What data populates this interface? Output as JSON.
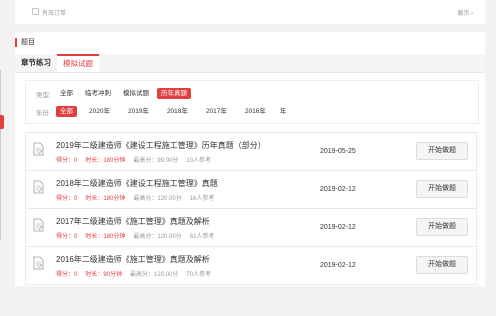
{
  "topbar": {
    "label": "有效订单",
    "right": "展示 ›"
  },
  "section": {
    "title": "题目"
  },
  "tabs": [
    {
      "label": "章节练习"
    },
    {
      "label": "模拟试题"
    }
  ],
  "filter": {
    "type_label": "类型:",
    "types": [
      "全部",
      "临考冲刺",
      "模拟试题",
      "历年真题"
    ],
    "year_label": "年份:",
    "years": [
      "全部",
      "2020年",
      "2019年",
      "2018年",
      "2017年",
      "2016年",
      "年"
    ]
  },
  "items": [
    {
      "title": "2019年二级建造师《建设工程施工管理》历年真题（部分）",
      "score": "得分：0",
      "duration": "时长：180分钟",
      "max": "最高分：99.00分",
      "count": "10人参考",
      "date": "2019-05-25",
      "button": "开始做题"
    },
    {
      "title": "2018年二级建造师《建设工程施工管理》真题",
      "score": "得分：0",
      "duration": "时长：180分钟",
      "max": "最高分：120.00分",
      "count": "16人参考",
      "date": "2019-02-12",
      "button": "开始做题"
    },
    {
      "title": "2017年二级建造师《施工管理》真题及解析",
      "score": "得分：0",
      "duration": "时长：180分钟",
      "max": "最高分：120.00分",
      "count": "61人参考",
      "date": "2019-02-12",
      "button": "开始做题"
    },
    {
      "title": "2016年二级建造师《施工管理》真题及解析",
      "score": "得分：0",
      "duration": "时长：90分钟",
      "max": "最高分：120.00分",
      "count": "70人参考",
      "date": "2019-02-12",
      "button": "开始做题"
    }
  ],
  "colors": {
    "accent": "#e04040"
  },
  "icons": {
    "doc": "document-edit-icon"
  }
}
